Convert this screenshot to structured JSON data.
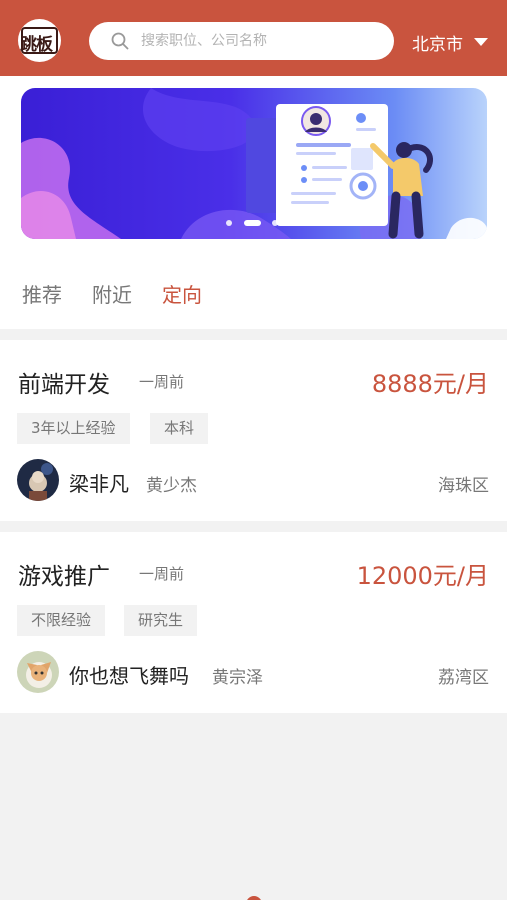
{
  "header": {
    "logo_text": "跳板",
    "search_placeholder": "搜索职位、公司名称",
    "city": "北京市"
  },
  "banner": {
    "slides": 3,
    "active_slide": 1
  },
  "tabs": [
    {
      "label": "推荐",
      "active": false
    },
    {
      "label": "附近",
      "active": false
    },
    {
      "label": "定向",
      "active": true
    }
  ],
  "jobs": [
    {
      "title": "前端开发",
      "time": "一周前",
      "salary": "8888元/月",
      "tags": [
        "3年以上经验",
        "本科"
      ],
      "poster": "梁非凡",
      "recruiter": "黄少杰",
      "district": "海珠区"
    },
    {
      "title": "游戏推广",
      "time": "一周前",
      "salary": "12000元/月",
      "tags": [
        "不限经验",
        "研究生"
      ],
      "poster": "你也想飞舞吗",
      "recruiter": "黄宗泽",
      "district": "荔湾区"
    }
  ],
  "colors": {
    "brand": "#c9543e",
    "text_primary": "#222222",
    "text_secondary": "#777777",
    "background": "#f2f2f2"
  }
}
